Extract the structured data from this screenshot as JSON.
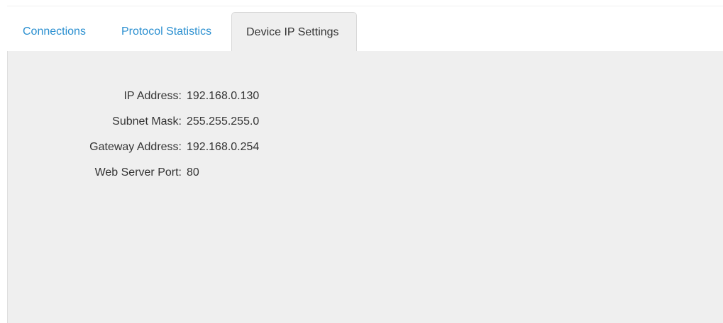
{
  "tabs": {
    "connections": "Connections",
    "protocol_statistics": "Protocol Statistics",
    "device_ip_settings": "Device IP Settings"
  },
  "device_ip_settings": {
    "rows": [
      {
        "label": "IP Address:",
        "value": "192.168.0.130"
      },
      {
        "label": "Subnet Mask:",
        "value": "255.255.255.0"
      },
      {
        "label": "Gateway Address:",
        "value": "192.168.0.254"
      },
      {
        "label": "Web Server Port:",
        "value": "80"
      }
    ]
  },
  "colors": {
    "tab_link": "#2a8fd0",
    "active_tab_text": "#333333",
    "panel_background": "#efefef",
    "border": "#d8d8d8"
  }
}
